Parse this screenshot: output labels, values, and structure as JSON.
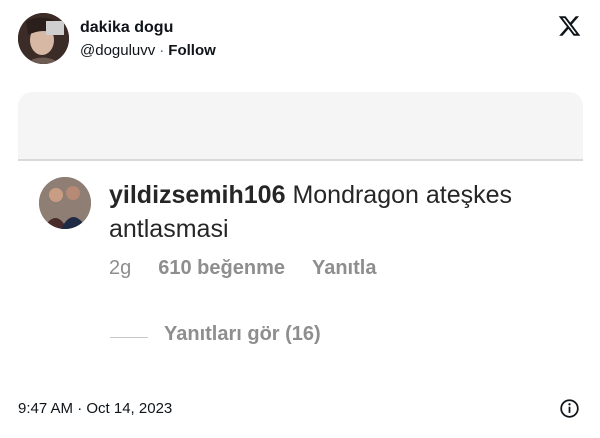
{
  "tweet": {
    "display_name": "dakika dogu",
    "handle": "@doguluvv",
    "separator": "·",
    "follow_label": "Follow",
    "timestamp": "9:47 AM · Oct 14, 2023"
  },
  "icons": {
    "platform_logo": "x-logo-icon",
    "info": "info-icon"
  },
  "media": {
    "comment": {
      "username": "yildizsemih106",
      "text": "Mondragon ateşkes antlasmasi",
      "age": "2g",
      "likes": "610 beğenme",
      "reply_label": "Yanıtla"
    },
    "view_replies_label": "Yanıtları gör (16)"
  }
}
